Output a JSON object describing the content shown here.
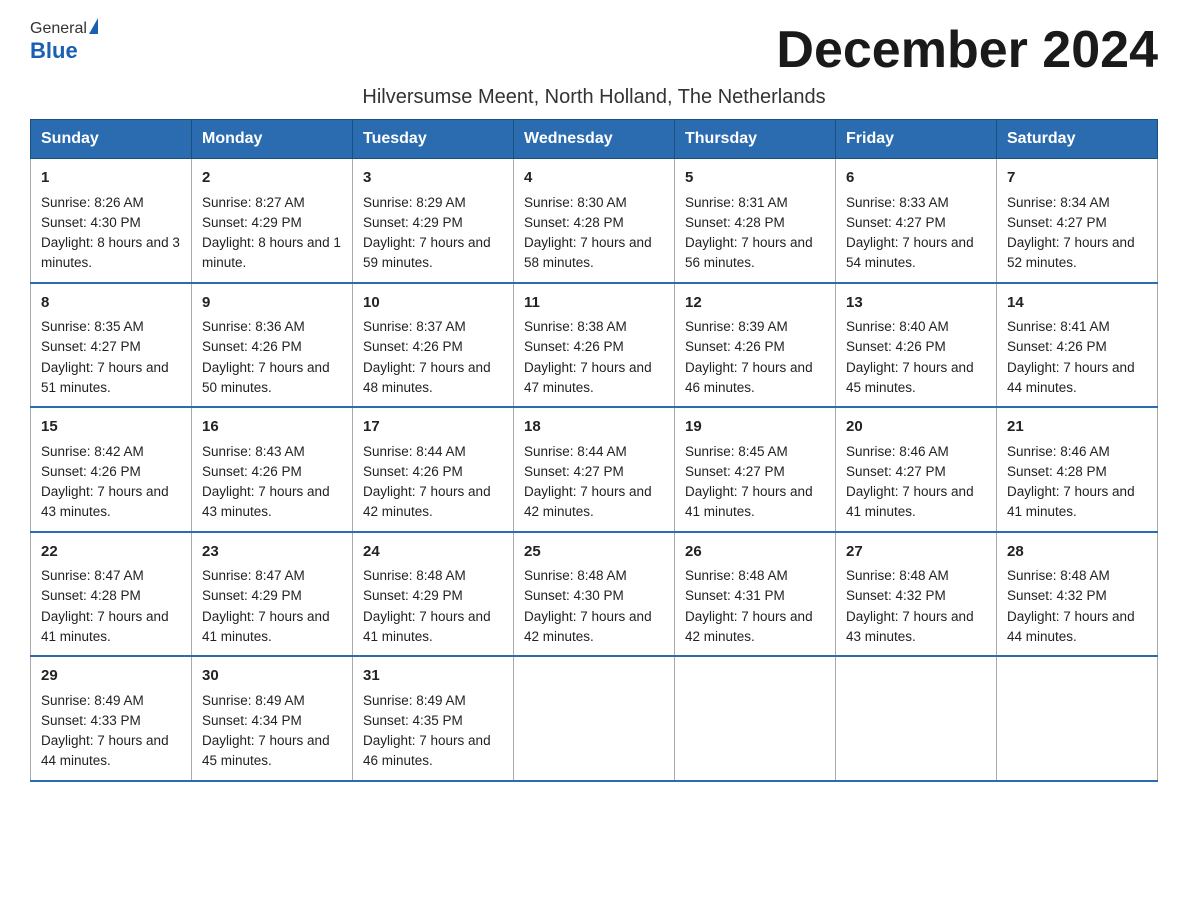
{
  "logo": {
    "general": "General",
    "triangle": "▶",
    "blue": "Blue"
  },
  "title": "December 2024",
  "subtitle": "Hilversumse Meent, North Holland, The Netherlands",
  "days_of_week": [
    "Sunday",
    "Monday",
    "Tuesday",
    "Wednesday",
    "Thursday",
    "Friday",
    "Saturday"
  ],
  "weeks": [
    [
      {
        "day": "1",
        "sunrise": "8:26 AM",
        "sunset": "4:30 PM",
        "daylight": "8 hours and 3 minutes."
      },
      {
        "day": "2",
        "sunrise": "8:27 AM",
        "sunset": "4:29 PM",
        "daylight": "8 hours and 1 minute."
      },
      {
        "day": "3",
        "sunrise": "8:29 AM",
        "sunset": "4:29 PM",
        "daylight": "7 hours and 59 minutes."
      },
      {
        "day": "4",
        "sunrise": "8:30 AM",
        "sunset": "4:28 PM",
        "daylight": "7 hours and 58 minutes."
      },
      {
        "day": "5",
        "sunrise": "8:31 AM",
        "sunset": "4:28 PM",
        "daylight": "7 hours and 56 minutes."
      },
      {
        "day": "6",
        "sunrise": "8:33 AM",
        "sunset": "4:27 PM",
        "daylight": "7 hours and 54 minutes."
      },
      {
        "day": "7",
        "sunrise": "8:34 AM",
        "sunset": "4:27 PM",
        "daylight": "7 hours and 52 minutes."
      }
    ],
    [
      {
        "day": "8",
        "sunrise": "8:35 AM",
        "sunset": "4:27 PM",
        "daylight": "7 hours and 51 minutes."
      },
      {
        "day": "9",
        "sunrise": "8:36 AM",
        "sunset": "4:26 PM",
        "daylight": "7 hours and 50 minutes."
      },
      {
        "day": "10",
        "sunrise": "8:37 AM",
        "sunset": "4:26 PM",
        "daylight": "7 hours and 48 minutes."
      },
      {
        "day": "11",
        "sunrise": "8:38 AM",
        "sunset": "4:26 PM",
        "daylight": "7 hours and 47 minutes."
      },
      {
        "day": "12",
        "sunrise": "8:39 AM",
        "sunset": "4:26 PM",
        "daylight": "7 hours and 46 minutes."
      },
      {
        "day": "13",
        "sunrise": "8:40 AM",
        "sunset": "4:26 PM",
        "daylight": "7 hours and 45 minutes."
      },
      {
        "day": "14",
        "sunrise": "8:41 AM",
        "sunset": "4:26 PM",
        "daylight": "7 hours and 44 minutes."
      }
    ],
    [
      {
        "day": "15",
        "sunrise": "8:42 AM",
        "sunset": "4:26 PM",
        "daylight": "7 hours and 43 minutes."
      },
      {
        "day": "16",
        "sunrise": "8:43 AM",
        "sunset": "4:26 PM",
        "daylight": "7 hours and 43 minutes."
      },
      {
        "day": "17",
        "sunrise": "8:44 AM",
        "sunset": "4:26 PM",
        "daylight": "7 hours and 42 minutes."
      },
      {
        "day": "18",
        "sunrise": "8:44 AM",
        "sunset": "4:27 PM",
        "daylight": "7 hours and 42 minutes."
      },
      {
        "day": "19",
        "sunrise": "8:45 AM",
        "sunset": "4:27 PM",
        "daylight": "7 hours and 41 minutes."
      },
      {
        "day": "20",
        "sunrise": "8:46 AM",
        "sunset": "4:27 PM",
        "daylight": "7 hours and 41 minutes."
      },
      {
        "day": "21",
        "sunrise": "8:46 AM",
        "sunset": "4:28 PM",
        "daylight": "7 hours and 41 minutes."
      }
    ],
    [
      {
        "day": "22",
        "sunrise": "8:47 AM",
        "sunset": "4:28 PM",
        "daylight": "7 hours and 41 minutes."
      },
      {
        "day": "23",
        "sunrise": "8:47 AM",
        "sunset": "4:29 PM",
        "daylight": "7 hours and 41 minutes."
      },
      {
        "day": "24",
        "sunrise": "8:48 AM",
        "sunset": "4:29 PM",
        "daylight": "7 hours and 41 minutes."
      },
      {
        "day": "25",
        "sunrise": "8:48 AM",
        "sunset": "4:30 PM",
        "daylight": "7 hours and 42 minutes."
      },
      {
        "day": "26",
        "sunrise": "8:48 AM",
        "sunset": "4:31 PM",
        "daylight": "7 hours and 42 minutes."
      },
      {
        "day": "27",
        "sunrise": "8:48 AM",
        "sunset": "4:32 PM",
        "daylight": "7 hours and 43 minutes."
      },
      {
        "day": "28",
        "sunrise": "8:48 AM",
        "sunset": "4:32 PM",
        "daylight": "7 hours and 44 minutes."
      }
    ],
    [
      {
        "day": "29",
        "sunrise": "8:49 AM",
        "sunset": "4:33 PM",
        "daylight": "7 hours and 44 minutes."
      },
      {
        "day": "30",
        "sunrise": "8:49 AM",
        "sunset": "4:34 PM",
        "daylight": "7 hours and 45 minutes."
      },
      {
        "day": "31",
        "sunrise": "8:49 AM",
        "sunset": "4:35 PM",
        "daylight": "7 hours and 46 minutes."
      },
      null,
      null,
      null,
      null
    ]
  ],
  "labels": {
    "sunrise": "Sunrise:",
    "sunset": "Sunset:",
    "daylight": "Daylight:"
  }
}
